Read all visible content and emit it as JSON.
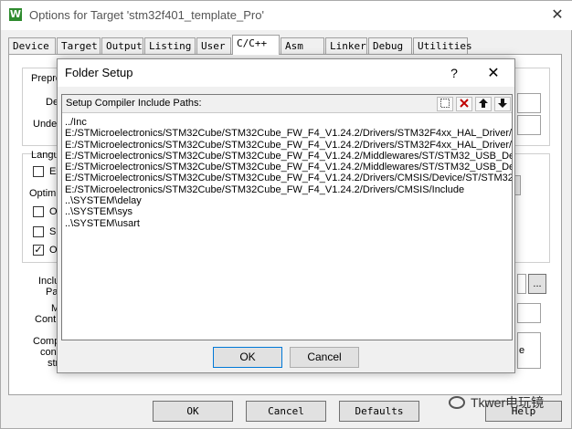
{
  "outer_window": {
    "title": "Options for Target 'stm32f401_template_Pro'",
    "close_glyph": "✕",
    "app_icon_letter": "W",
    "tabs": [
      {
        "label": "Device"
      },
      {
        "label": "Target"
      },
      {
        "label": "Output"
      },
      {
        "label": "Listing"
      },
      {
        "label": "User"
      },
      {
        "label": "C/C++",
        "active": true
      },
      {
        "label": "Asm"
      },
      {
        "label": "Linker"
      },
      {
        "label": "Debug"
      },
      {
        "label": "Utilities"
      }
    ],
    "background_fragments": {
      "preprocessor": "Prepro",
      "define": "Def",
      "undefine": "Undefi",
      "language": "Langu",
      "ex_option": "Ex",
      "optimization": "Optimiz",
      "op_option": "Op",
      "sp_option": "Sp",
      "on_option": "On",
      "include": "Inclu",
      "paths": "Path",
      "misc": "M",
      "controls": "Contro",
      "compiler": "Comp",
      "control": "con",
      "string": "str",
      "browse_label": "...",
      "right_fragment": "e"
    },
    "buttons": {
      "ok": "OK",
      "cancel": "Cancel",
      "defaults": "Defaults",
      "help": "Help"
    },
    "watermark": "Tkwer电玩镜"
  },
  "folder_setup": {
    "title": "Folder Setup",
    "help_glyph": "?",
    "close_glyph": "✕",
    "list_header": "Setup Compiler Include Paths:",
    "toolbar_icons": [
      "new-folder-icon",
      "delete-icon",
      "move-up-icon",
      "move-down-icon"
    ],
    "paths": [
      "../Inc",
      "E:/STMicroelectronics/STM32Cube/STM32Cube_FW_F4_V1.24.2/Drivers/STM32F4xx_HAL_Driver/In",
      "E:/STMicroelectronics/STM32Cube/STM32Cube_FW_F4_V1.24.2/Drivers/STM32F4xx_HAL_Driver/In",
      "E:/STMicroelectronics/STM32Cube/STM32Cube_FW_F4_V1.24.2/Middlewares/ST/STM32_USB_De",
      "E:/STMicroelectronics/STM32Cube/STM32Cube_FW_F4_V1.24.2/Middlewares/ST/STM32_USB_De",
      "E:/STMicroelectronics/STM32Cube/STM32Cube_FW_F4_V1.24.2/Drivers/CMSIS/Device/ST/STM32",
      "E:/STMicroelectronics/STM32Cube/STM32Cube_FW_F4_V1.24.2/Drivers/CMSIS/Include",
      "..\\SYSTEM\\delay",
      "..\\SYSTEM\\sys",
      "..\\SYSTEM\\usart"
    ],
    "ok_label": "OK",
    "cancel_label": "Cancel"
  }
}
